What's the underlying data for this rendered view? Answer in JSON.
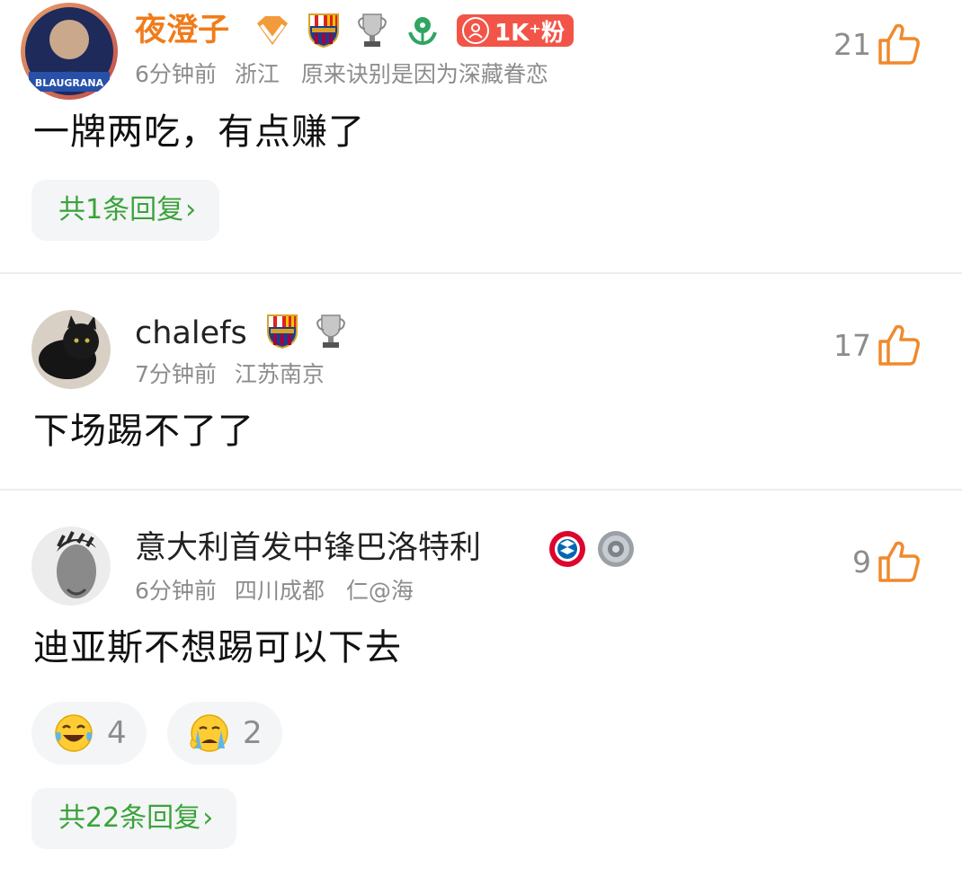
{
  "comments": [
    {
      "username": "夜澄子",
      "time": "6分钟前",
      "location": "浙江",
      "signature": "原来诀别是因为深藏眷恋",
      "avatar_text": "BLAUGRANA",
      "fans_badge": "1K⁺粉",
      "text": "一牌两吃，有点赚了",
      "likes": "21",
      "replies_label": "共1条回复",
      "badges": [
        "vip-diamond-icon",
        "barcelona-crest-icon",
        "trophy-icon",
        "green-plant-icon",
        "fans-badge"
      ]
    },
    {
      "username": "chalefs",
      "time": "7分钟前",
      "location": "江苏南京",
      "text": "下场踢不了了",
      "likes": "17",
      "badges": [
        "barcelona-crest-icon",
        "trophy-icon"
      ]
    },
    {
      "username": "意大利首发中锋巴洛特利",
      "time": "6分钟前",
      "location": "四川成都",
      "signature": "仁@海",
      "text": "迪亚斯不想踢可以下去",
      "likes": "9",
      "badges": [
        "bayern-crest-icon",
        "plate-trophy-icon"
      ],
      "reactions": [
        {
          "icon": "laughing-tears-emoji",
          "count": "4"
        },
        {
          "icon": "crying-emoji",
          "count": "2"
        }
      ],
      "replies_label": "共22条回复"
    }
  ],
  "colors": {
    "vip_name": "#f07c1a",
    "reply_green": "#3aa33b",
    "like_orange": "#f08a2c",
    "fans_red": "#f25548"
  },
  "reply_chevron": "›"
}
